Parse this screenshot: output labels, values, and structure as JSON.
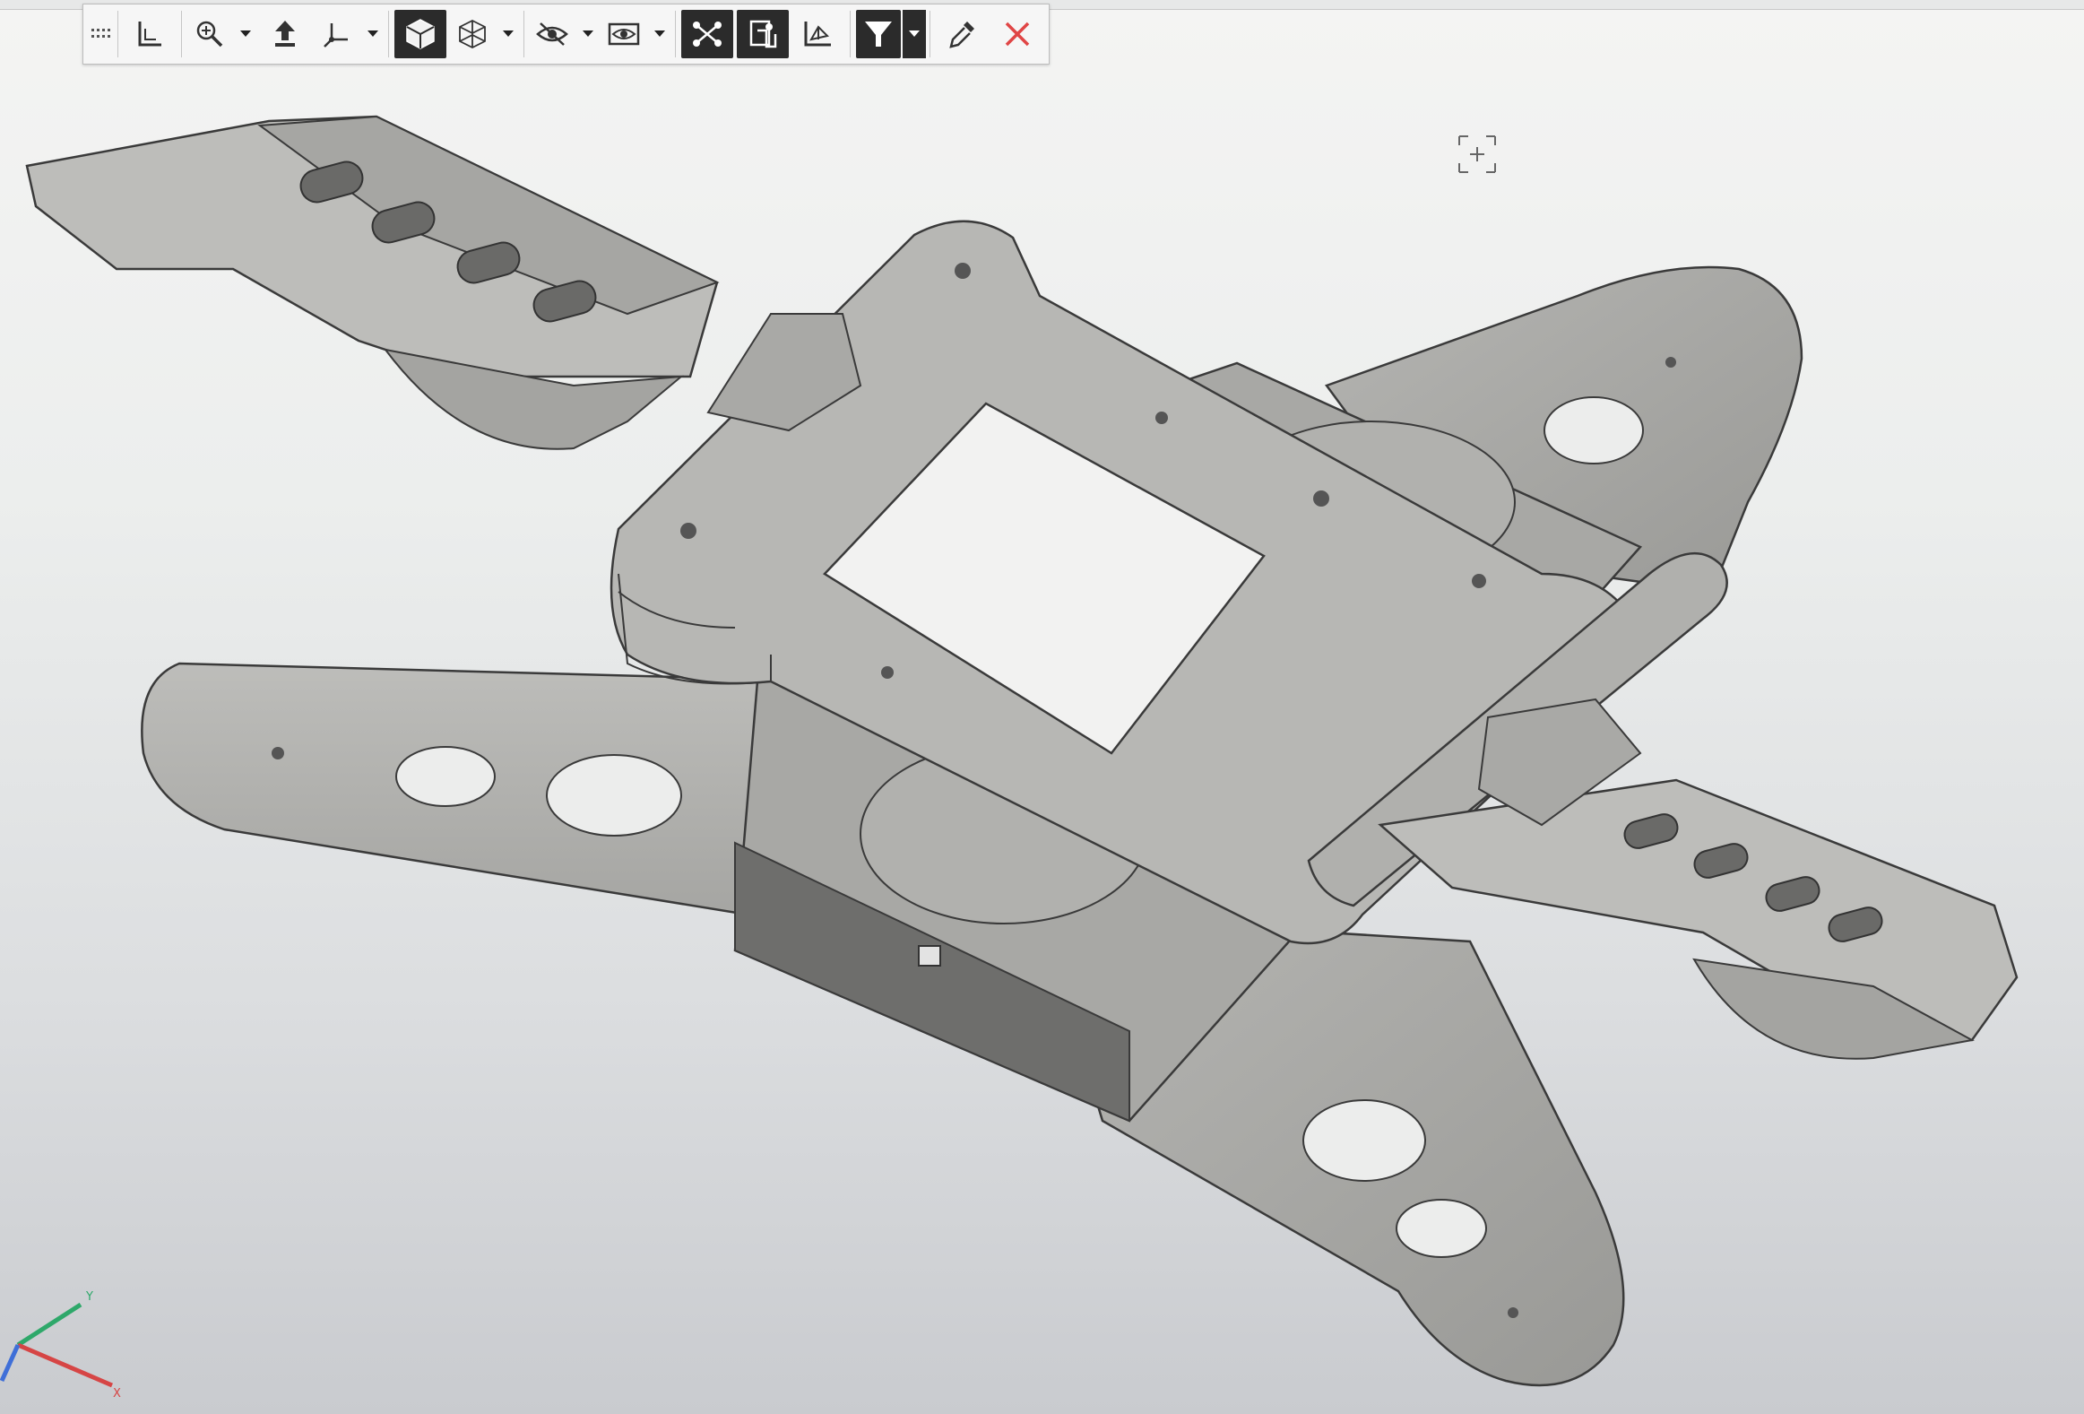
{
  "colors": {
    "model_fill": "#a9a9a6",
    "model_fill_dark": "#8b8b88",
    "model_edge": "#3a3a3a",
    "toolbar_active": "#2b2b2b",
    "close_red": "#e04545"
  },
  "toolbar": {
    "items": [
      {
        "icon": "grip-icon"
      },
      {
        "icon": "sketch-plane-icon"
      },
      {
        "icon": "zoom-to-area-icon",
        "dropdown": true
      },
      {
        "icon": "move-up-icon"
      },
      {
        "icon": "view-orientation-icon",
        "dropdown": true
      },
      {
        "icon": "shaded-display-icon",
        "active": true
      },
      {
        "icon": "wireframe-display-icon",
        "dropdown": true
      },
      {
        "icon": "hide-show-icon",
        "dropdown": true
      },
      {
        "icon": "visibility-icon",
        "dropdown": true
      },
      {
        "icon": "mate-display-icon",
        "active": true
      },
      {
        "icon": "component-display-icon",
        "active": true
      },
      {
        "icon": "section-view-icon"
      },
      {
        "icon": "selection-filter-icon",
        "active": true,
        "dropdown": true
      },
      {
        "icon": "appearance-dropper-icon"
      },
      {
        "icon": "close-icon"
      }
    ]
  },
  "viewport": {
    "model": "quadrotor-frame-assembly",
    "cursor_icon": "zoom-box-cursor-icon",
    "triad_icon": "coordinate-triad-icon"
  }
}
